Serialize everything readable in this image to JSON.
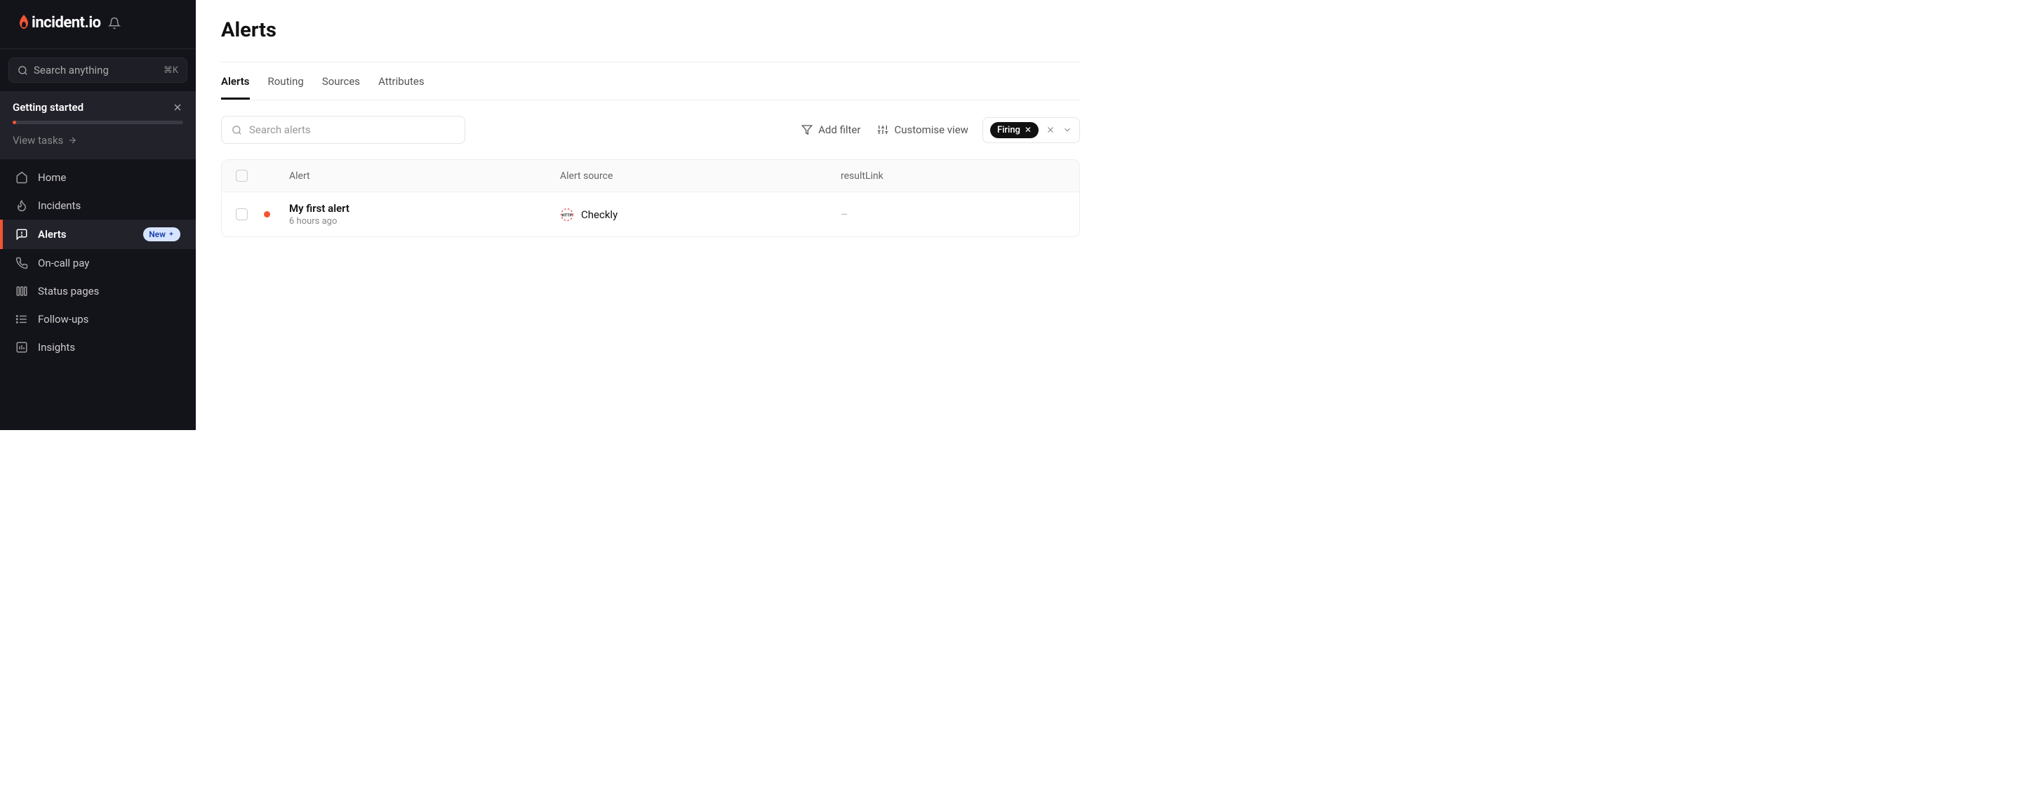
{
  "brand": {
    "name": "incident.io"
  },
  "search": {
    "placeholder": "Search anything",
    "shortcut": "⌘K"
  },
  "getting_started": {
    "title": "Getting started",
    "view_tasks": "View tasks"
  },
  "sidebar": {
    "items": [
      {
        "label": "Home",
        "icon": "home"
      },
      {
        "label": "Incidents",
        "icon": "flame"
      },
      {
        "label": "Alerts",
        "icon": "alert",
        "active": true,
        "badge": "New"
      },
      {
        "label": "On-call pay",
        "icon": "phone"
      },
      {
        "label": "Status pages",
        "icon": "bars"
      },
      {
        "label": "Follow-ups",
        "icon": "list"
      },
      {
        "label": "Insights",
        "icon": "chart"
      }
    ]
  },
  "header": {
    "title": "Alerts"
  },
  "tabs": [
    {
      "label": "Alerts",
      "active": true
    },
    {
      "label": "Routing"
    },
    {
      "label": "Sources"
    },
    {
      "label": "Attributes"
    }
  ],
  "toolbar": {
    "search_placeholder": "Search alerts",
    "add_filter": "Add filter",
    "customise_view": "Customise view",
    "active_filter": "Firing"
  },
  "table": {
    "headers": {
      "alert": "Alert",
      "source": "Alert source",
      "result": "resultLink"
    },
    "rows": [
      {
        "title": "My first alert",
        "subtitle": "6 hours ago",
        "source": "Checkly",
        "result": "–"
      }
    ]
  }
}
